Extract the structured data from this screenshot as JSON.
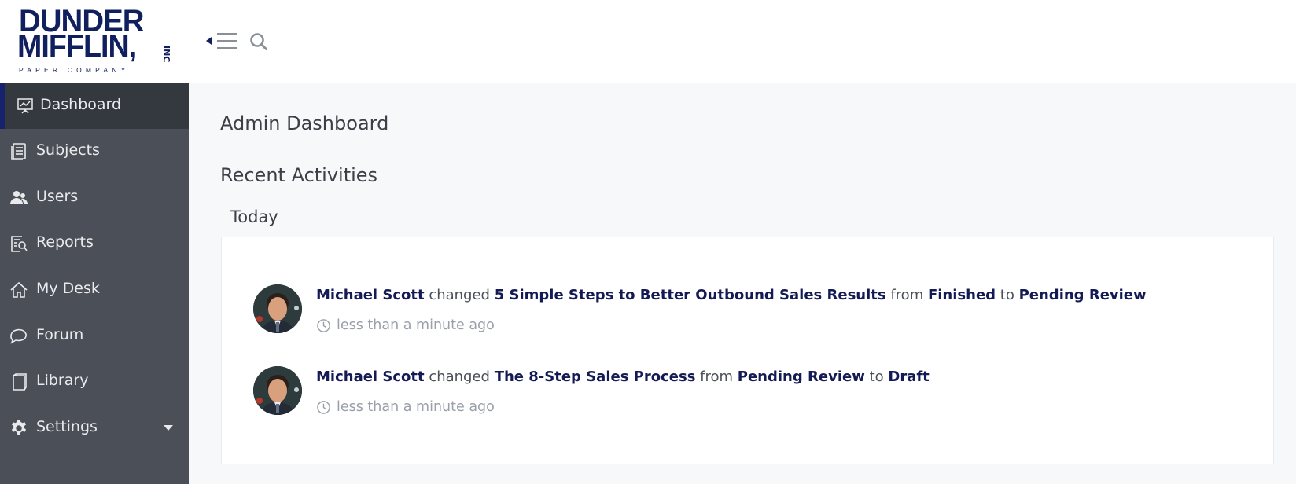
{
  "brand": {
    "line1": "DUNDER",
    "line2": "MIFFLIN,",
    "inc": "INC",
    "tagline": "PAPER COMPANY",
    "color": "#101f5e"
  },
  "header": {
    "toggle_icon": "menu-toggle-icon",
    "search_icon": "search-icon"
  },
  "sidebar": {
    "background": "#4b4f57",
    "active_background": "#34383f",
    "items": [
      {
        "label": "Dashboard",
        "icon": "presentation-chart-icon",
        "active": true
      },
      {
        "label": "Subjects",
        "icon": "document-list-icon"
      },
      {
        "label": "Users",
        "icon": "users-icon"
      },
      {
        "label": "Reports",
        "icon": "report-search-icon"
      },
      {
        "label": "My Desk",
        "icon": "home-icon"
      },
      {
        "label": "Forum",
        "icon": "chat-bubble-icon"
      },
      {
        "label": "Library",
        "icon": "book-icon"
      },
      {
        "label": "Settings",
        "icon": "gear-icon",
        "has_dropdown": true
      }
    ]
  },
  "main": {
    "page_title": "Admin Dashboard",
    "section_title": "Recent Activities",
    "day_label": "Today",
    "activities": [
      {
        "user": "Michael Scott",
        "verb": "changed",
        "subject": "5 Simple Steps to Better Outbound Sales Results",
        "from_word": "from",
        "from_status": "Finished",
        "to_word": "to",
        "to_status": "Pending Review",
        "time": "less than a minute ago"
      },
      {
        "user": "Michael Scott",
        "verb": "changed",
        "subject": "The 8-Step Sales Process",
        "from_word": "from",
        "from_status": "Pending Review",
        "to_word": "to",
        "to_status": "Draft",
        "time": "less than a minute ago"
      }
    ]
  }
}
